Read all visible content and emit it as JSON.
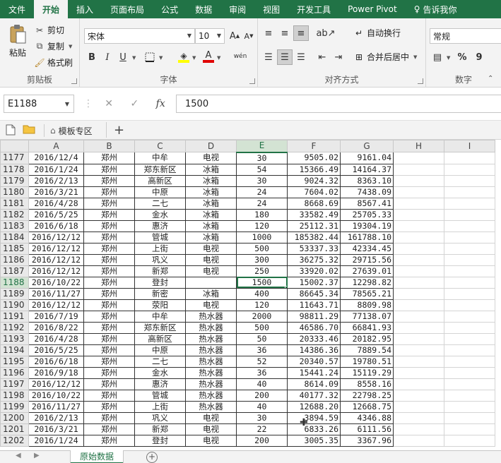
{
  "ribbon_tabs": [
    {
      "label": "文件",
      "active": false
    },
    {
      "label": "开始",
      "active": true
    },
    {
      "label": "插入",
      "active": false
    },
    {
      "label": "页面布局",
      "active": false
    },
    {
      "label": "公式",
      "active": false
    },
    {
      "label": "数据",
      "active": false
    },
    {
      "label": "审阅",
      "active": false
    },
    {
      "label": "视图",
      "active": false
    },
    {
      "label": "开发工具",
      "active": false
    },
    {
      "label": "Power Pivot",
      "active": false
    }
  ],
  "tell_me": "告诉我你",
  "clipboard": {
    "paste": "粘贴",
    "cut": "剪切",
    "copy": "复制",
    "format_painter": "格式刷",
    "group_label": "剪贴板"
  },
  "font": {
    "name": "宋体",
    "size": "10",
    "bold": "B",
    "italic": "I",
    "underline": "U",
    "phonetic": "wén",
    "group_label": "字体"
  },
  "alignment": {
    "wrap_text": "自动换行",
    "merge_center": "合并后居中",
    "group_label": "对齐方式"
  },
  "number": {
    "format": "常规",
    "percent": "%",
    "comma": "9",
    "group_label": "数字"
  },
  "formula_bar": {
    "name_box": "E1188",
    "fx": "fx",
    "value": "1500"
  },
  "quick_bar": {
    "template_zone": "模板专区",
    "add": "+"
  },
  "columns": [
    "A",
    "B",
    "C",
    "D",
    "E",
    "F",
    "G",
    "H",
    "I"
  ],
  "selected_column": "E",
  "selected_row": "1188",
  "rows": [
    {
      "n": "1177",
      "a": "2016/12/4",
      "b": "郑州",
      "c": "中牟",
      "d": "电视",
      "e": "30",
      "f": "9505.02",
      "g": "9161.04"
    },
    {
      "n": "1178",
      "a": "2016/1/24",
      "b": "郑州",
      "c": "郑东新区",
      "d": "冰箱",
      "e": "54",
      "f": "15366.49",
      "g": "14164.37"
    },
    {
      "n": "1179",
      "a": "2016/2/13",
      "b": "郑州",
      "c": "高新区",
      "d": "冰箱",
      "e": "30",
      "f": "9024.32",
      "g": "8363.10"
    },
    {
      "n": "1180",
      "a": "2016/3/21",
      "b": "郑州",
      "c": "中原",
      "d": "冰箱",
      "e": "24",
      "f": "7604.02",
      "g": "7438.09"
    },
    {
      "n": "1181",
      "a": "2016/4/28",
      "b": "郑州",
      "c": "二七",
      "d": "冰箱",
      "e": "24",
      "f": "8668.69",
      "g": "8567.41"
    },
    {
      "n": "1182",
      "a": "2016/5/25",
      "b": "郑州",
      "c": "金水",
      "d": "冰箱",
      "e": "180",
      "f": "33582.49",
      "g": "25705.33"
    },
    {
      "n": "1183",
      "a": "2016/6/18",
      "b": "郑州",
      "c": "惠济",
      "d": "冰箱",
      "e": "120",
      "f": "25112.31",
      "g": "19304.19"
    },
    {
      "n": "1184",
      "a": "2016/12/12",
      "b": "郑州",
      "c": "管城",
      "d": "冰箱",
      "e": "1000",
      "f": "185382.44",
      "g": "161788.10"
    },
    {
      "n": "1185",
      "a": "2016/12/12",
      "b": "郑州",
      "c": "上街",
      "d": "电视",
      "e": "500",
      "f": "53337.33",
      "g": "42334.45"
    },
    {
      "n": "1186",
      "a": "2016/12/12",
      "b": "郑州",
      "c": "巩义",
      "d": "电视",
      "e": "300",
      "f": "36275.32",
      "g": "29715.56"
    },
    {
      "n": "1187",
      "a": "2016/12/12",
      "b": "郑州",
      "c": "新郑",
      "d": "电视",
      "e": "250",
      "f": "33920.02",
      "g": "27639.01"
    },
    {
      "n": "1188",
      "a": "2016/10/22",
      "b": "郑州",
      "c": "登封",
      "d": "",
      "e": "1500",
      "f": "15002.37",
      "g": "12298.82"
    },
    {
      "n": "1189",
      "a": "2016/11/27",
      "b": "郑州",
      "c": "新密",
      "d": "冰箱",
      "e": "400",
      "f": "86645.34",
      "g": "78565.21"
    },
    {
      "n": "1190",
      "a": "2016/12/12",
      "b": "郑州",
      "c": "荥阳",
      "d": "电视",
      "e": "120",
      "f": "11643.71",
      "g": "8809.98"
    },
    {
      "n": "1191",
      "a": "2016/7/19",
      "b": "郑州",
      "c": "中牟",
      "d": "热水器",
      "e": "2000",
      "f": "98811.29",
      "g": "77138.07"
    },
    {
      "n": "1192",
      "a": "2016/8/22",
      "b": "郑州",
      "c": "郑东新区",
      "d": "热水器",
      "e": "500",
      "f": "46586.70",
      "g": "66841.93"
    },
    {
      "n": "1193",
      "a": "2016/4/28",
      "b": "郑州",
      "c": "高新区",
      "d": "热水器",
      "e": "50",
      "f": "20333.46",
      "g": "20182.95"
    },
    {
      "n": "1194",
      "a": "2016/5/25",
      "b": "郑州",
      "c": "中原",
      "d": "热水器",
      "e": "36",
      "f": "14386.36",
      "g": "7889.54"
    },
    {
      "n": "1195",
      "a": "2016/6/18",
      "b": "郑州",
      "c": "二七",
      "d": "热水器",
      "e": "52",
      "f": "20340.57",
      "g": "19780.51"
    },
    {
      "n": "1196",
      "a": "2016/9/18",
      "b": "郑州",
      "c": "金水",
      "d": "热水器",
      "e": "36",
      "f": "15441.24",
      "g": "15119.29"
    },
    {
      "n": "1197",
      "a": "2016/12/12",
      "b": "郑州",
      "c": "惠济",
      "d": "热水器",
      "e": "40",
      "f": "8614.09",
      "g": "8558.16"
    },
    {
      "n": "1198",
      "a": "2016/10/22",
      "b": "郑州",
      "c": "管城",
      "d": "热水器",
      "e": "200",
      "f": "40177.32",
      "g": "22798.25"
    },
    {
      "n": "1199",
      "a": "2016/11/27",
      "b": "郑州",
      "c": "上街",
      "d": "热水器",
      "e": "40",
      "f": "12688.20",
      "g": "12668.75"
    },
    {
      "n": "1200",
      "a": "2016/2/13",
      "b": "郑州",
      "c": "巩义",
      "d": "电视",
      "e": "30",
      "f": "3894.59",
      "g": "4346.88"
    },
    {
      "n": "1201",
      "a": "2016/3/21",
      "b": "郑州",
      "c": "新郑",
      "d": "电视",
      "e": "22",
      "f": "6833.26",
      "g": "6111.56"
    },
    {
      "n": "1202",
      "a": "2016/1/24",
      "b": "郑州",
      "c": "登封",
      "d": "电视",
      "e": "200",
      "f": "3005.35",
      "g": "3367.96"
    }
  ],
  "sheet_tab": "原始数据",
  "add_sheet": "+"
}
